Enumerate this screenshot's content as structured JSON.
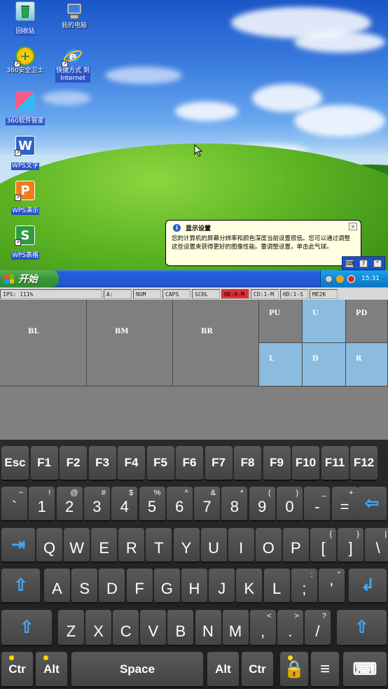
{
  "desktop": {
    "icons": [
      {
        "label": "回收站",
        "name": "recycle-bin"
      },
      {
        "label": "我的电脑",
        "name": "my-computer"
      },
      {
        "label": "360安全卫士",
        "name": "360-security"
      },
      {
        "label": "快捷方式 到\nInternet",
        "name": "internet-shortcut"
      },
      {
        "label": "360软件管家",
        "name": "360-software-manager"
      },
      {
        "label": "WPS文字",
        "name": "wps-writer"
      },
      {
        "label": "WPS演示",
        "name": "wps-presentation"
      },
      {
        "label": "WPS表格",
        "name": "wps-spreadsheet"
      }
    ],
    "balloon": {
      "title": "显示设置",
      "body": "您的计算机的屏幕分辨率和颜色深度当前设置很低。您可以通过调整这些设置来获得更好的图像性能。要调整设置，单击此气球。",
      "close": "×"
    },
    "minitoolbar": [
      "⌨",
      "?",
      "⌃"
    ],
    "taskbar": {
      "start_label": "开始",
      "clock": "15:31"
    }
  },
  "statusbar": {
    "ips": "IPS: 111%",
    "drive_a": "A:",
    "num": "NUM",
    "caps": "CAPS",
    "scrl": "SCRL",
    "hd0": "HD:0-M",
    "cd": "CD:1-M",
    "hd1": "HD:1-S",
    "me2k": "ME2K"
  },
  "touchpad": {
    "bl": "BL",
    "bm": "BM",
    "br": "BR",
    "pu": "PU",
    "u": "U",
    "pd": "PD",
    "l": "L",
    "d": "D",
    "r": "R"
  },
  "keyboard": {
    "row1": [
      "Esc",
      "F1",
      "F2",
      "F3",
      "F4",
      "F5",
      "F6",
      "F7",
      "F8",
      "F9",
      "F10",
      "F11",
      "F12"
    ],
    "row2": [
      {
        "main": "`",
        "sub": "~"
      },
      {
        "main": "1",
        "sub": "!"
      },
      {
        "main": "2",
        "sub": "@"
      },
      {
        "main": "3",
        "sub": "#"
      },
      {
        "main": "4",
        "sub": "$"
      },
      {
        "main": "5",
        "sub": "%"
      },
      {
        "main": "6",
        "sub": "^"
      },
      {
        "main": "7",
        "sub": "&"
      },
      {
        "main": "8",
        "sub": "*"
      },
      {
        "main": "9",
        "sub": "("
      },
      {
        "main": "0",
        "sub": ")"
      },
      {
        "main": "-",
        "sub": "_"
      },
      {
        "main": "=",
        "sub": "+"
      }
    ],
    "row3": [
      {
        "main": "Q"
      },
      {
        "main": "W"
      },
      {
        "main": "E"
      },
      {
        "main": "R"
      },
      {
        "main": "T"
      },
      {
        "main": "Y"
      },
      {
        "main": "U"
      },
      {
        "main": "I"
      },
      {
        "main": "O"
      },
      {
        "main": "P"
      },
      {
        "main": "[",
        "sub": "{"
      },
      {
        "main": "]",
        "sub": "}"
      },
      {
        "main": "\\",
        "sub": "|"
      }
    ],
    "row4": [
      {
        "main": "A"
      },
      {
        "main": "S"
      },
      {
        "main": "D"
      },
      {
        "main": "F"
      },
      {
        "main": "G"
      },
      {
        "main": "H"
      },
      {
        "main": "J"
      },
      {
        "main": "K"
      },
      {
        "main": "L"
      },
      {
        "main": ";",
        "sub": ":"
      },
      {
        "main": "'",
        "sub": "\""
      }
    ],
    "row5": [
      {
        "main": "Z"
      },
      {
        "main": "X"
      },
      {
        "main": "C"
      },
      {
        "main": "V"
      },
      {
        "main": "B"
      },
      {
        "main": "N"
      },
      {
        "main": "M"
      },
      {
        "main": ",",
        "sub": "<"
      },
      {
        "main": ".",
        "sub": ">"
      },
      {
        "main": "/",
        "sub": "?"
      }
    ],
    "row6": {
      "ctrl_left": "Ctr",
      "alt_left": "Alt",
      "space": "Space",
      "alt_right": "Alt",
      "ctrl_right": "Ctr"
    }
  },
  "colors": {
    "tp_active": "#8bbcdf",
    "arrow_blue": "#3fa9ff",
    "modifier_dot": "#ffd700"
  }
}
